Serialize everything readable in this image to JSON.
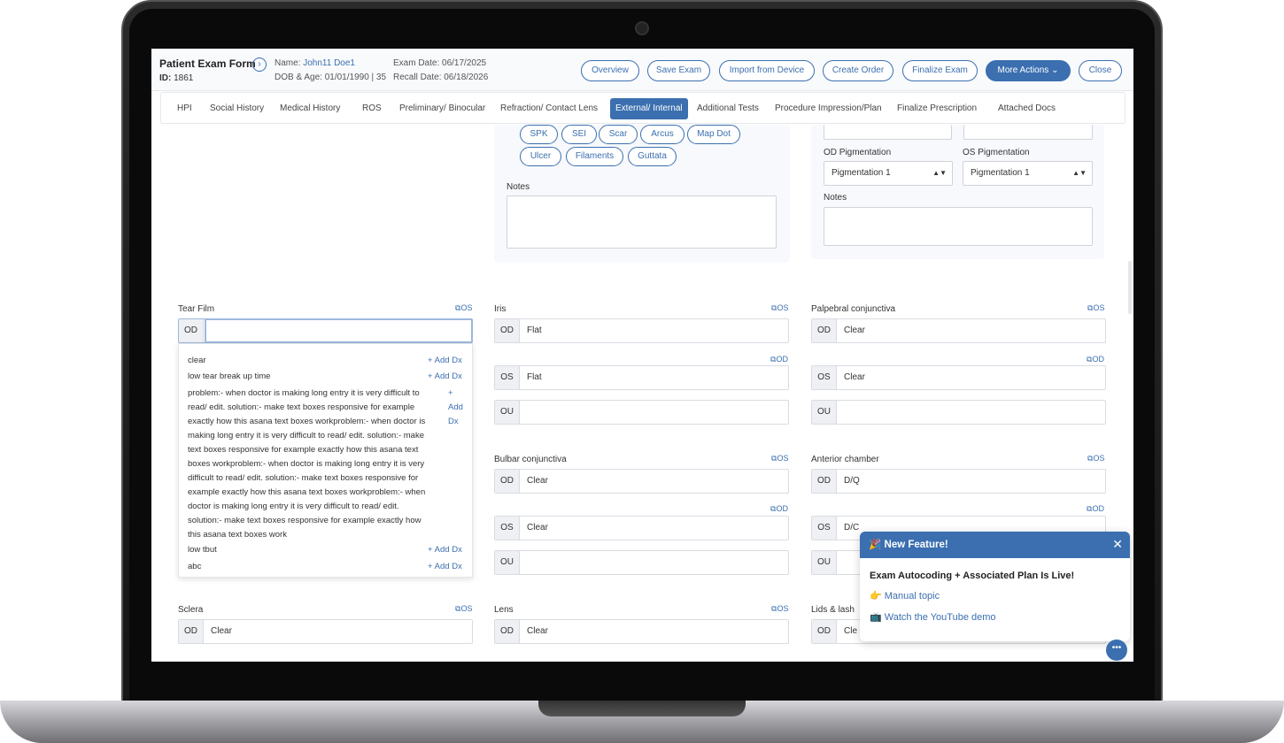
{
  "header": {
    "title": "Patient Exam Form",
    "id_label": "ID:",
    "id_value": "1861",
    "name_label": "Name:",
    "name_value": "John11 Doe1",
    "dob_label": "DOB & Age:",
    "dob_value": "01/01/1990 | 35",
    "exam_date_label": "Exam Date:",
    "exam_date_value": "06/17/2025",
    "recall_label": "Recall Date:",
    "recall_value": "06/18/2026",
    "buttons": {
      "overview": "Overview",
      "save": "Save Exam",
      "import": "Import from Device",
      "order": "Create Order",
      "finalize": "Finalize Exam",
      "more": "More Actions",
      "close": "Close"
    }
  },
  "tabs": [
    "HPI",
    "Social History",
    "Medical History",
    "ROS",
    "Preliminary/ Binocular",
    "Refraction/ Contact Lens",
    "External/ Internal",
    "Additional Tests",
    "Procedure Impression/Plan",
    "Finalize Prescription",
    "Attached Docs"
  ],
  "cornea": {
    "chips": [
      "SPK",
      "SEI",
      "Scar",
      "Arcus",
      "Map Dot",
      "Ulcer",
      "Filaments",
      "Guttata"
    ],
    "notes_label": "Notes"
  },
  "pigment": {
    "od_label": "OD Pigmentation",
    "os_label": "OS Pigmentation",
    "od_value": "Pigmentation 1",
    "os_value": "Pigmentation 1",
    "notes_label": "Notes"
  },
  "copy": {
    "os": "OS",
    "od": "OD"
  },
  "eyes": {
    "od": "OD",
    "os": "OS",
    "ou": "OU"
  },
  "sections": {
    "tear_film": {
      "label": "Tear Film",
      "od": ""
    },
    "iris": {
      "label": "Iris",
      "od": "Flat",
      "os": "Flat",
      "ou": ""
    },
    "palpebral": {
      "label": "Palpebral conjunctiva",
      "od": "Clear",
      "os": "Clear",
      "ou": ""
    },
    "bulbar": {
      "label": "Bulbar conjunctiva",
      "od": "Clear",
      "os": "Clear",
      "ou": ""
    },
    "anterior": {
      "label": "Anterior chamber",
      "od": "D/Q",
      "os": "D/C",
      "ou": ""
    },
    "sclera": {
      "label": "Sclera",
      "od": "Clear"
    },
    "lens": {
      "label": "Lens",
      "od": "Clear"
    },
    "lids": {
      "label": "Lids & lash",
      "od": "Cle"
    }
  },
  "dropdown": {
    "items": [
      "clear",
      "low tear break up time",
      "low tbut",
      "abc"
    ],
    "long_lines": [
      "problem:- when doctor is making long entry it is very difficult to",
      "read/ edit. solution:- make text boxes responsive for example",
      "exactly how this asana text boxes workproblem:- when doctor is",
      "making long entry it is very difficult to read/ edit. solution:- make",
      "text boxes responsive for example exactly how this asana text",
      "boxes workproblem:- when doctor is making long entry it is very",
      "difficult to read/ edit. solution:- make text boxes responsive for",
      "example exactly how this asana text boxes workproblem:- when",
      "doctor is making long entry it is very difficult to read/ edit.",
      "solution:- make text boxes responsive for example exactly how",
      "this asana text boxes work"
    ],
    "add_dx": "+ Add Dx",
    "add_split": [
      "+",
      "Add",
      "Dx"
    ]
  },
  "popup": {
    "title": "🎉 New Feature!",
    "heading": "Exam Autocoding + Associated Plan Is Live!",
    "link1": "👉 Manual topic",
    "link2": "📺 Watch the YouTube demo"
  },
  "colors": {
    "accent": "#3b6fb0"
  }
}
